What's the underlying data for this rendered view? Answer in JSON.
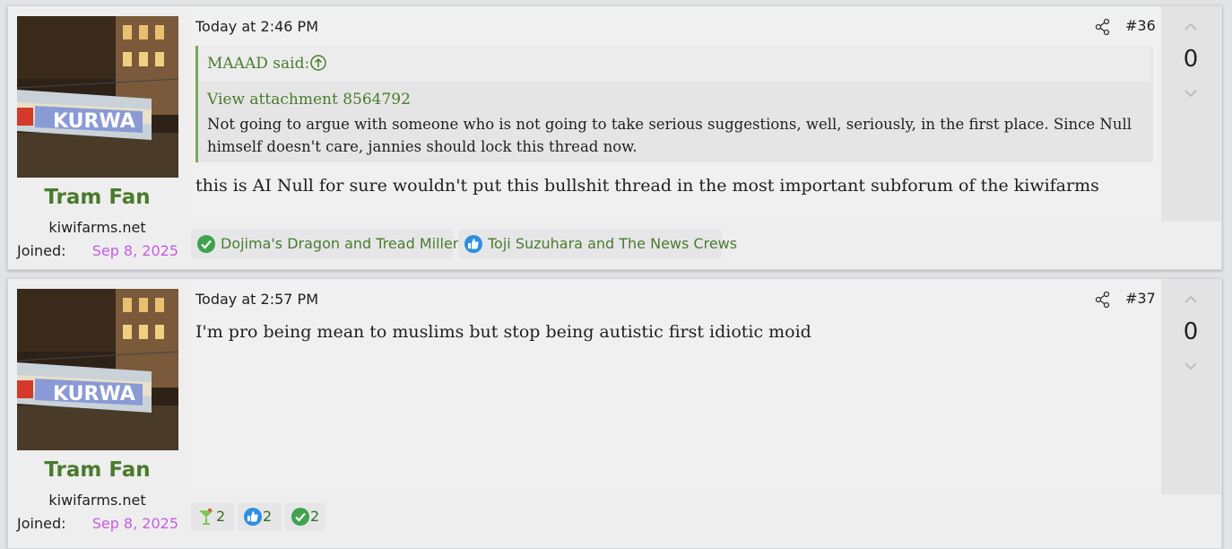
{
  "posts": [
    {
      "username": "Tram Fan",
      "user_title": "kiwifarms.net",
      "joined_label": "Joined:",
      "joined_date": "Sep 8, 2025",
      "time": "Today at 2:46 PM",
      "post_number": "#36",
      "vote_count": "0",
      "quote": {
        "author": "MAAAD said:",
        "attachment": "View attachment 8564792",
        "text": "Not going to argue with someone who is not going to take serious suggestions, well, seriously, in the first place. Since Null himself doesn't care, jannies should lock this thread now."
      },
      "body": "this is AI Null for sure wouldn't put this bullshit thread in the most important subforum of the kiwifarms",
      "reactions": [
        {
          "icon": "checkmark-icon",
          "label": "Dojima's Dragon and Tread Miller"
        },
        {
          "icon": "thumbs-up-icon",
          "label": "Toji Suzuhara and The News Crews"
        }
      ]
    },
    {
      "username": "Tram Fan",
      "user_title": "kiwifarms.net",
      "joined_label": "Joined:",
      "joined_date": "Sep 8, 2025",
      "time": "Today at 2:57 PM",
      "post_number": "#37",
      "vote_count": "0",
      "body": "I'm pro being mean to muslims but stop being autistic first idiotic moid",
      "reactions": [
        {
          "icon": "cocktail-icon",
          "label": "2"
        },
        {
          "icon": "thumbs-up-icon",
          "label": "2"
        },
        {
          "icon": "checkmark-icon",
          "label": "2"
        }
      ]
    }
  ],
  "colors": {
    "accent_green": "#4a7b2d",
    "join_date": "#c95ae4",
    "quote_bar": "#7aa85a",
    "thumbs_blue": "#2d8fe0",
    "check_green": "#3fa34d"
  }
}
